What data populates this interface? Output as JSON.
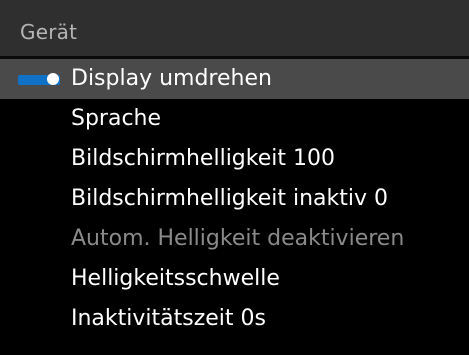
{
  "header": {
    "title": "Gerät"
  },
  "menu": {
    "items": [
      {
        "label": "Display umdrehen",
        "selected": true,
        "enabled": true
      },
      {
        "label": "Sprache",
        "selected": false,
        "enabled": true
      },
      {
        "label": "Bildschirmhelligkeit 100",
        "selected": false,
        "enabled": true
      },
      {
        "label": "Bildschirmhelligkeit inaktiv 0",
        "selected": false,
        "enabled": true
      },
      {
        "label": "Autom. Helligkeit deaktivieren",
        "selected": false,
        "enabled": false
      },
      {
        "label": "Helligkeitsschwelle",
        "selected": false,
        "enabled": true
      },
      {
        "label": "Inaktivitätszeit 0s",
        "selected": false,
        "enabled": true
      }
    ]
  },
  "colors": {
    "accent": "#0f72c7",
    "header_bg": "#2f2f2f",
    "selected_bg": "#4a4a4a",
    "text": "#ffffff",
    "disabled_text": "#8a8a8a"
  }
}
